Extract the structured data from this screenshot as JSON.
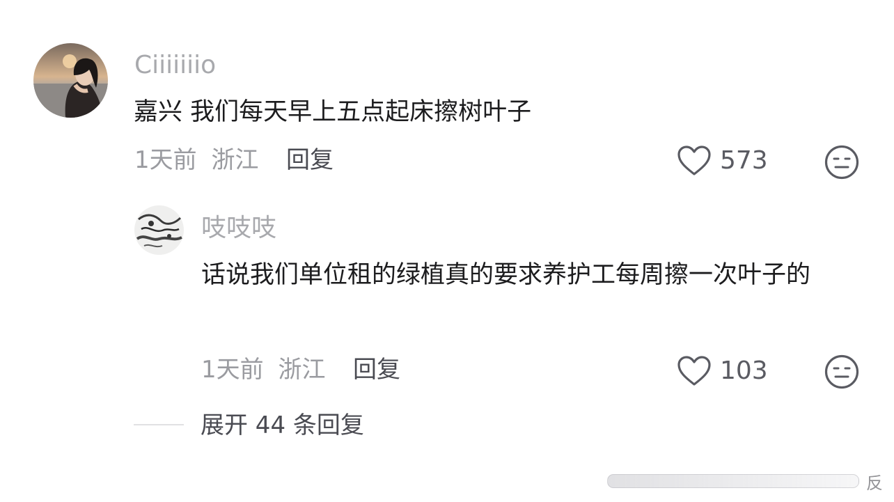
{
  "comment": {
    "username": "Ciiiiiiio",
    "text": "嘉兴 我们每天早上五点起床擦树叶子",
    "time": "1天前",
    "location": "浙江",
    "reply_label": "回复",
    "likes": "573"
  },
  "reply": {
    "username": "吱吱吱",
    "text": "话说我们单位租的绿植真的要求养护工每周擦一次叶子的",
    "time": "1天前",
    "location": "浙江",
    "reply_label": "回复",
    "likes": "103"
  },
  "expand_label": "展开 44 条回复",
  "watermark": {
    "icon": "weibo-watermark-icon",
    "text": "反"
  },
  "icons": {
    "like": "heart-outline-icon",
    "dislike": "neutral-face-icon"
  }
}
